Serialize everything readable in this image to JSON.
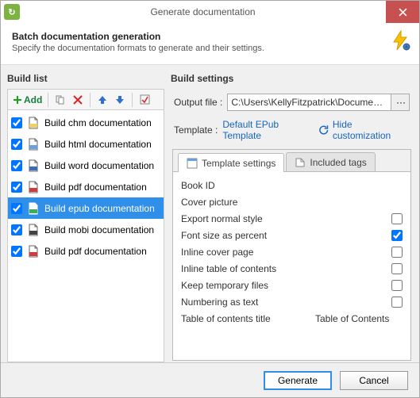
{
  "title": "Generate documentation",
  "header": {
    "h1": "Batch documentation generation",
    "sub": "Specify the documentation formats to generate and their settings."
  },
  "buildList": {
    "label": "Build list",
    "addLabel": "Add",
    "items": [
      {
        "label": "Build chm documentation",
        "checked": true,
        "icon": "chm",
        "selected": false
      },
      {
        "label": "Build html documentation",
        "checked": true,
        "icon": "html",
        "selected": false
      },
      {
        "label": "Build word documentation",
        "checked": true,
        "icon": "word",
        "selected": false
      },
      {
        "label": "Build pdf documentation",
        "checked": true,
        "icon": "pdf",
        "selected": false
      },
      {
        "label": "Build epub documentation",
        "checked": true,
        "icon": "epub",
        "selected": true
      },
      {
        "label": "Build mobi documentation",
        "checked": true,
        "icon": "mobi",
        "selected": false
      },
      {
        "label": "Build pdf documentation",
        "checked": true,
        "icon": "pdf",
        "selected": false
      }
    ]
  },
  "buildSettings": {
    "label": "Build settings",
    "outputLabel": "Output file :",
    "outputValue": "C:\\Users\\KellyFitzpatrick\\Documents\\HelpND",
    "browseDots": "···",
    "templateLabel": "Template :",
    "templateValue": "Default EPub Template",
    "hideCustomization": "Hide customization",
    "tabs": {
      "settings": "Template settings",
      "tags": "Included tags"
    },
    "rows": [
      {
        "label": "Book ID",
        "type": "none"
      },
      {
        "label": "Cover picture",
        "type": "none"
      },
      {
        "label": "Export normal style",
        "type": "check",
        "checked": false
      },
      {
        "label": "Font size as percent",
        "type": "check",
        "checked": true
      },
      {
        "label": "Inline cover page",
        "type": "check",
        "checked": false
      },
      {
        "label": "Inline table of contents",
        "type": "check",
        "checked": false
      },
      {
        "label": "Keep temporary files",
        "type": "check",
        "checked": false
      },
      {
        "label": "Numbering as text",
        "type": "check",
        "checked": false
      },
      {
        "label": "Table of contents title",
        "type": "text",
        "value": "Table of Contents"
      }
    ]
  },
  "footer": {
    "generate": "Generate",
    "cancel": "Cancel"
  }
}
